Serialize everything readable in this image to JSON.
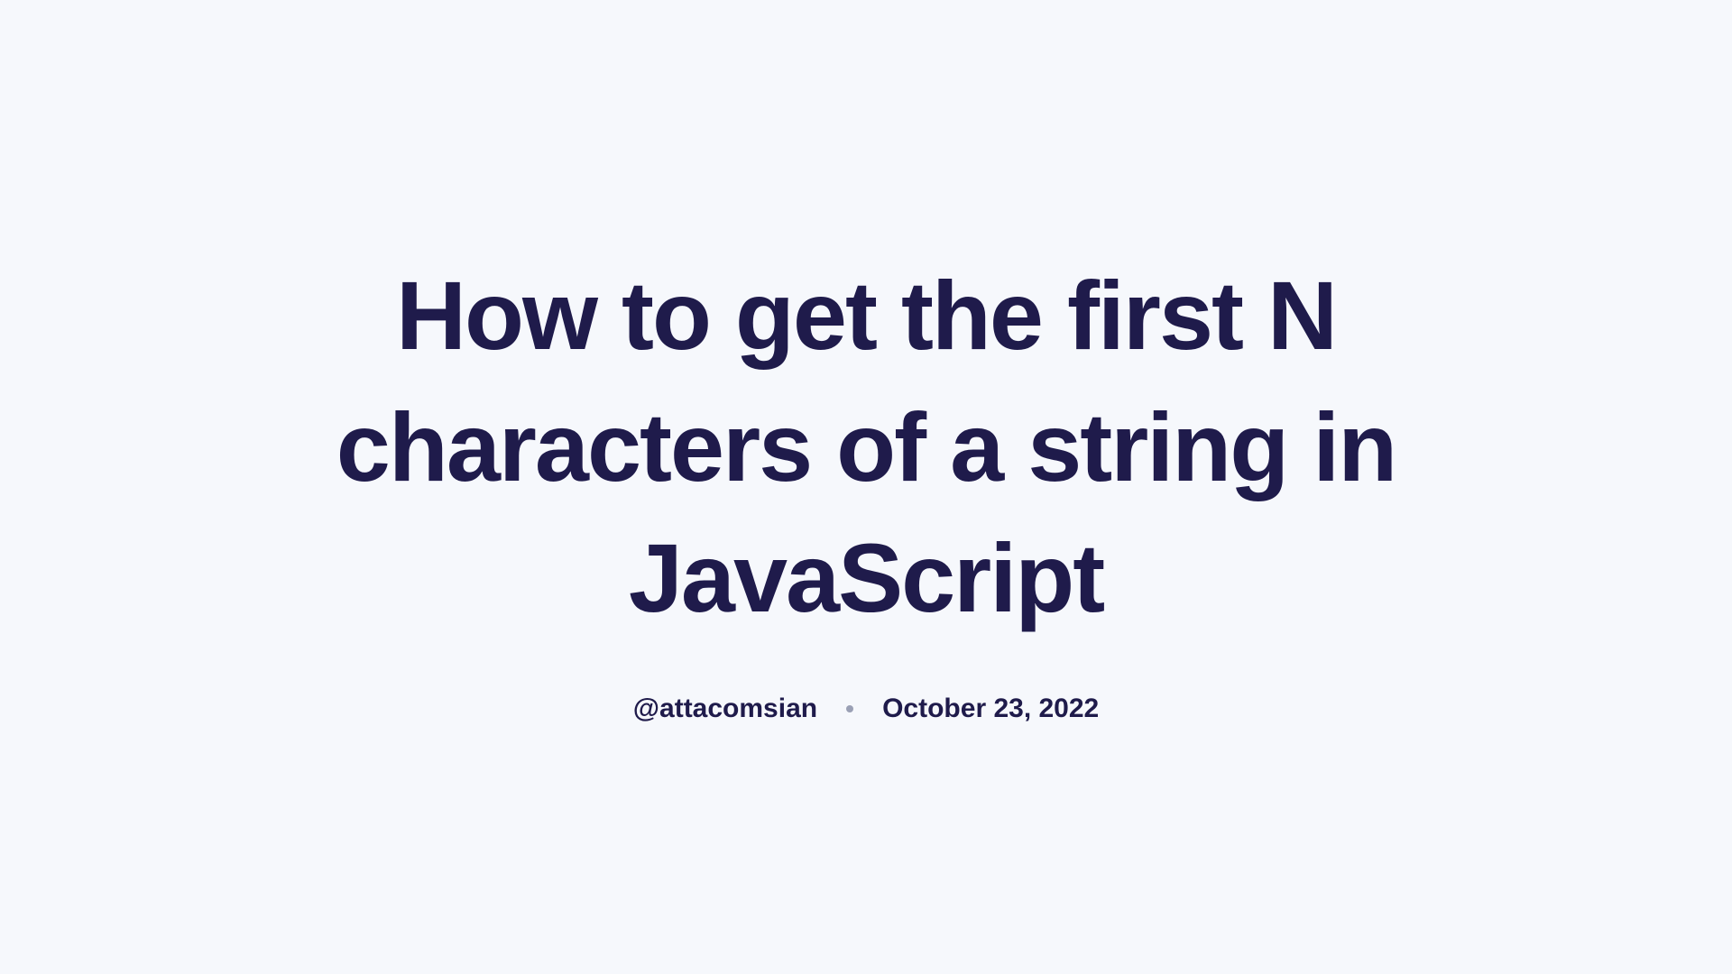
{
  "article": {
    "title": "How to get the first N characters of a string in JavaScript",
    "author": "@attacomsian",
    "date": "October 23, 2022"
  }
}
